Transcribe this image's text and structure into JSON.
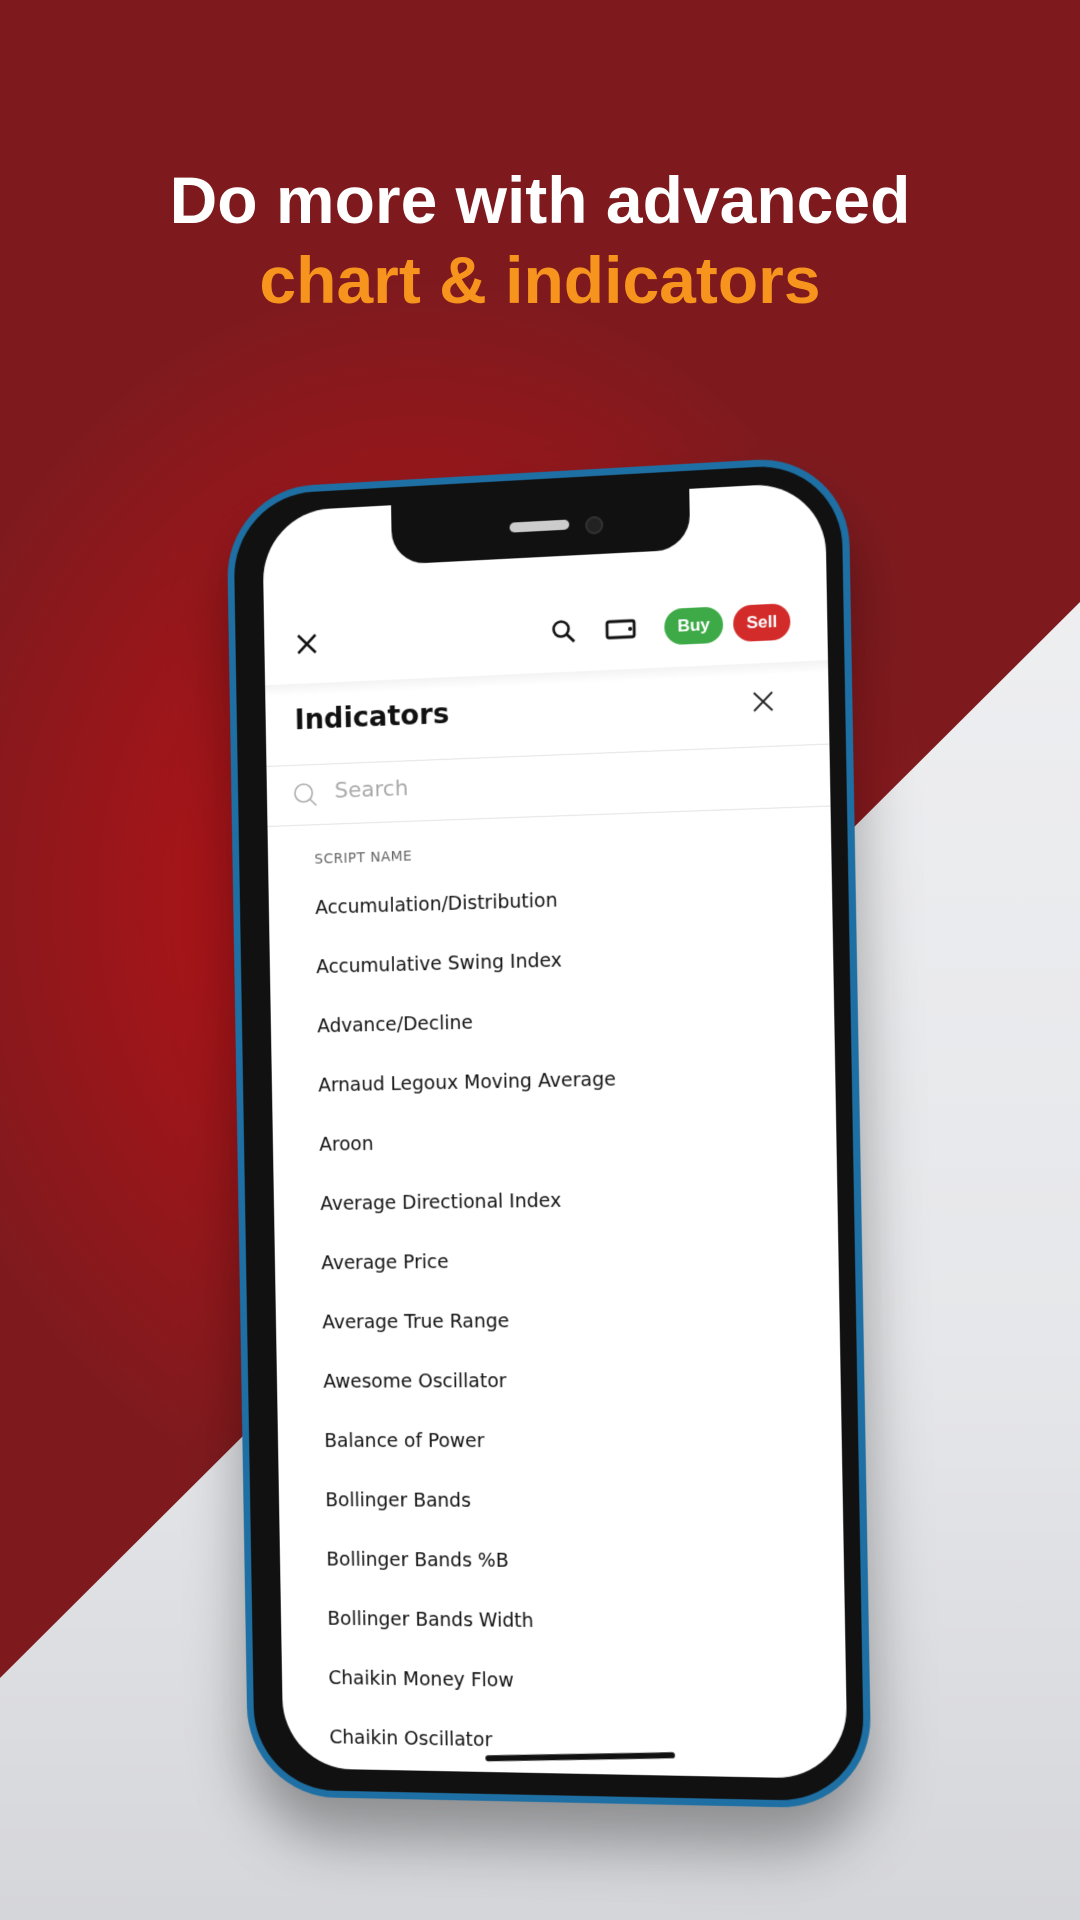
{
  "headline": {
    "line1": "Do more with advanced",
    "line2": "chart & indicators",
    "accent_color": "#f7941d"
  },
  "topbar": {
    "close_icon": "close-icon",
    "search_icon": "search-icon",
    "device_icon": "device-icon",
    "buy_label": "Buy",
    "sell_label": "Sell",
    "buy_color": "#3daa47",
    "sell_color": "#d32a2a"
  },
  "panel": {
    "title": "Indicators",
    "search_placeholder": "Search",
    "column_header": "SCRIPT NAME",
    "items": [
      "Accumulation/Distribution",
      "Accumulative Swing Index",
      "Advance/Decline",
      "Arnaud Legoux Moving Average",
      "Aroon",
      "Average Directional Index",
      "Average Price",
      "Average True Range",
      "Awesome Oscillator",
      "Balance of Power",
      "Bollinger Bands",
      "Bollinger Bands %B",
      "Bollinger Bands Width",
      "Chaikin Money Flow",
      "Chaikin Oscillator"
    ]
  }
}
